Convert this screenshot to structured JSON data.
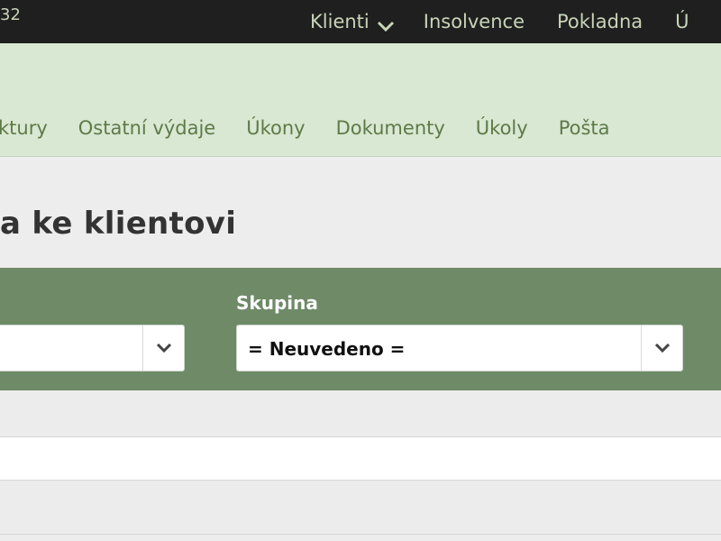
{
  "topbar": {
    "counter": "32",
    "nav": [
      {
        "label": "Klienti",
        "has_dropdown": true
      },
      {
        "label": "Insolvence"
      },
      {
        "label": "Pokladna"
      },
      {
        "label": "Ú"
      }
    ]
  },
  "subnav": {
    "tabs": [
      {
        "label": "ktury"
      },
      {
        "label": "Ostatní výdaje"
      },
      {
        "label": "Úkony"
      },
      {
        "label": "Dokumenty"
      },
      {
        "label": "Úkoly"
      },
      {
        "label": "Pošta"
      }
    ]
  },
  "page": {
    "title": "a ke klientovi"
  },
  "filters": {
    "first": {
      "value": ""
    },
    "group": {
      "label": "Skupina",
      "value": "= Neuvedeno ="
    }
  },
  "colors": {
    "topbar_bg": "#1f1f1f",
    "nav_text": "#c8d4b8",
    "green_band": "#d9e8d2",
    "tab_text": "#5e7a48",
    "filter_bar": "#6e8a67"
  }
}
